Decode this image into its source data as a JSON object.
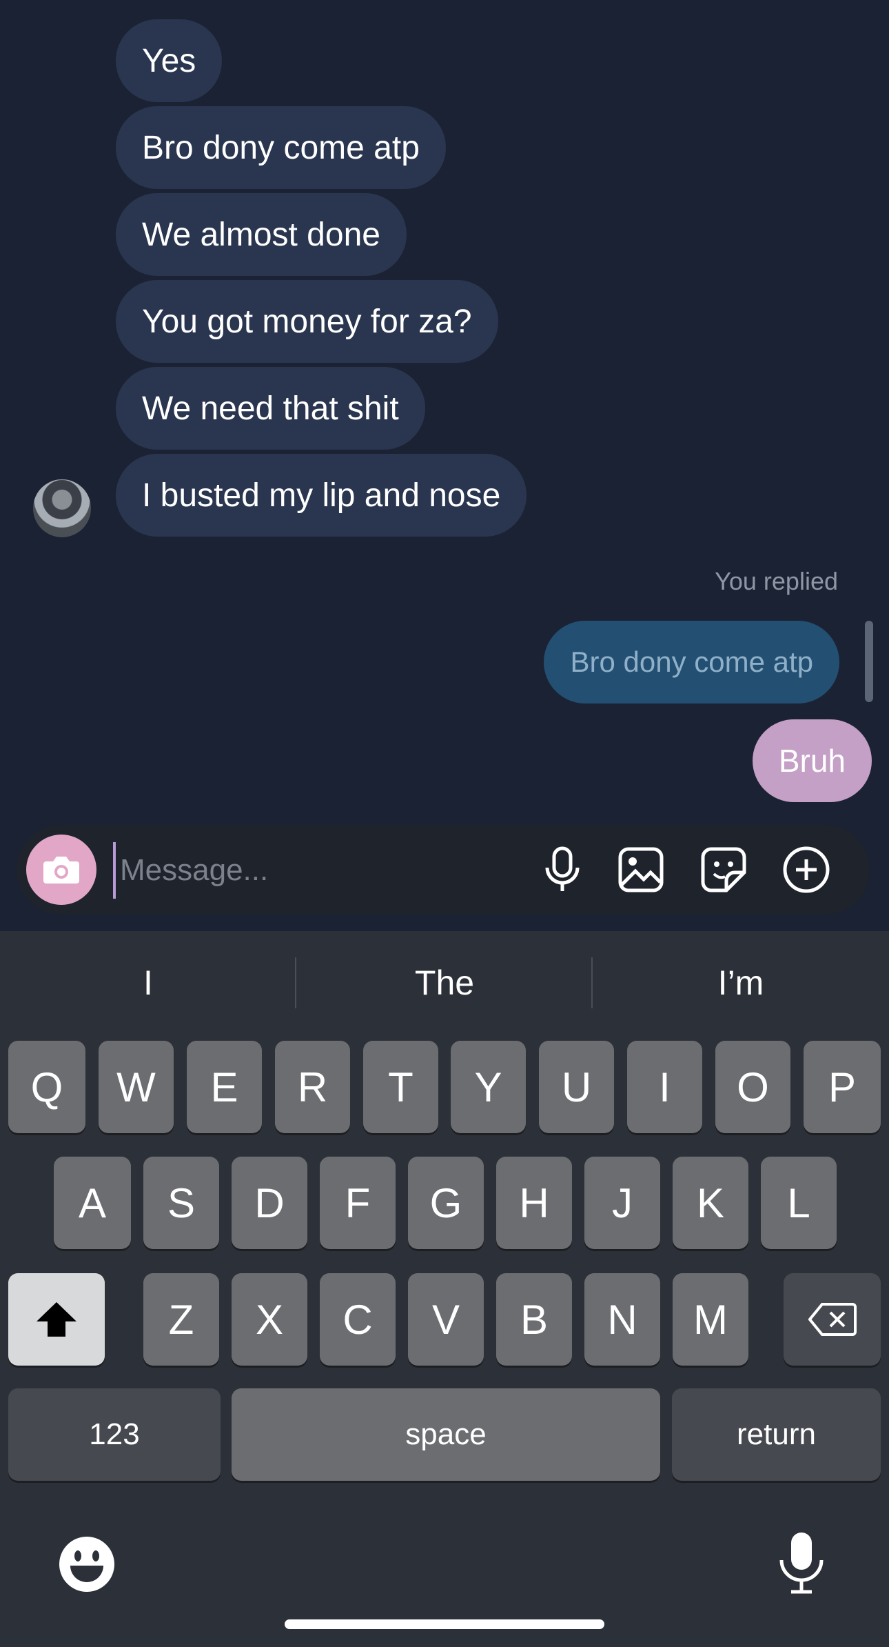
{
  "chat": {
    "incoming_messages": [
      "Yes",
      "Bro dony come atp",
      "We almost done",
      "You got money for za?",
      "We need that shit",
      "I busted my lip and nose"
    ],
    "reply_label": "You replied",
    "replied_to_message": "Bro dony come atp",
    "sent_message": "Bruh"
  },
  "composer": {
    "placeholder": "Message...",
    "icons": [
      "camera-icon",
      "microphone-icon",
      "image-icon",
      "sticker-icon",
      "plus-icon"
    ]
  },
  "keyboard": {
    "suggestions": [
      "I",
      "The",
      "I’m"
    ],
    "row1": [
      "Q",
      "W",
      "E",
      "R",
      "T",
      "Y",
      "U",
      "I",
      "O",
      "P"
    ],
    "row2": [
      "A",
      "S",
      "D",
      "F",
      "G",
      "H",
      "J",
      "K",
      "L"
    ],
    "row3": [
      "Z",
      "X",
      "C",
      "V",
      "B",
      "N",
      "M"
    ],
    "numbers_label": "123",
    "space_label": "space",
    "return_label": "return"
  },
  "colors": {
    "background": "#1b2233",
    "incoming_bubble": "#2a3650",
    "reply_bubble": "#234f72",
    "sent_bubble": "#c49fc6",
    "camera_button": "#e2a7c7",
    "keyboard": "#2c3038"
  }
}
